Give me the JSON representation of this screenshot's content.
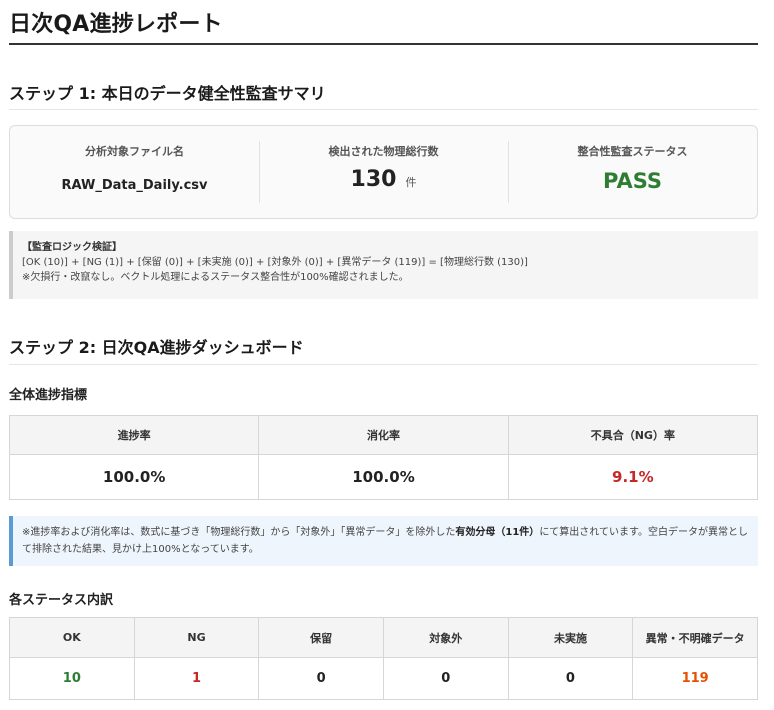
{
  "report": {
    "title": "日次QA進捗レポート"
  },
  "step1": {
    "heading": "ステップ 1: 本日のデータ健全性監査サマリ",
    "summary": {
      "file_label": "分析対象ファイル名",
      "file_value": "RAW_Data_Daily.csv",
      "rows_label": "検出された物理総行数",
      "rows_value": "130",
      "rows_unit": "件",
      "status_label": "整合性監査ステータス",
      "status_value": "PASS"
    },
    "logic": {
      "title": "【監査ロジック検証】",
      "formula": "[OK (10)] + [NG (1)] + [保留 (0)] + [未実施 (0)] + [対象外 (0)] + [異常データ (119)] = [物理総行数 (130)]",
      "note": "※欠損行・改竄なし。ベクトル処理によるステータス整合性が100%確認されました。"
    }
  },
  "step2": {
    "heading": "ステップ 2: 日次QA進捗ダッシュボード",
    "metrics_heading": "全体進捗指標",
    "metrics": {
      "headers": [
        "進捗率",
        "消化率",
        "不具合（NG）率"
      ],
      "values": [
        "100.0%",
        "100.0%",
        "9.1%"
      ]
    },
    "note": {
      "text_before": "※進捗率および消化率は、数式に基づき「物理総行数」から「対象外」「異常データ」を除外した",
      "text_bold": "有効分母（11件）",
      "text_after": "にて算出されています。空白データが異常として排除された結果、見かけ上100%となっています。"
    },
    "status_heading": "各ステータス内訳",
    "status": {
      "headers": [
        "OK",
        "NG",
        "保留",
        "対象外",
        "未実施",
        "異常・不明確データ"
      ],
      "values": [
        "10",
        "1",
        "0",
        "0",
        "0",
        "119"
      ]
    }
  },
  "colors": {
    "pass_green": "#2e7d32",
    "ng_red": "#c62828",
    "anomaly_orange": "#e65100",
    "note_accent": "#5b9bd5"
  }
}
